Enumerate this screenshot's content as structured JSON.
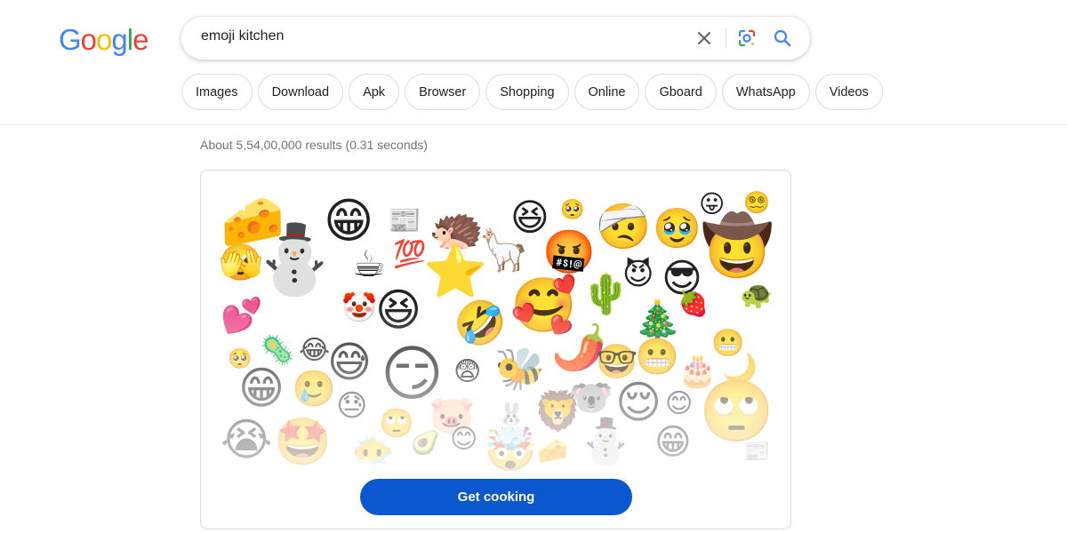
{
  "logo": {
    "letters": [
      "G",
      "o",
      "o",
      "g",
      "l",
      "e"
    ],
    "colors": [
      "#4285F4",
      "#EA4335",
      "#FBBC05",
      "#4285F4",
      "#34A853",
      "#EA4335"
    ]
  },
  "search": {
    "value": "emoji kitchen",
    "clear_icon": "close-icon",
    "lens_icon": "google-lens-icon",
    "search_icon": "search-icon"
  },
  "chips": [
    "Images",
    "Download",
    "Apk",
    "Browser",
    "Shopping",
    "Online",
    "Gboard",
    "WhatsApp",
    "Videos"
  ],
  "result_stats": "About 5,54,00,000 results (0.31 seconds)",
  "card": {
    "button_label": "Get cooking",
    "emojis": [
      "🧀",
      "⛄",
      "😁",
      "📰",
      "🦔",
      "😆",
      "🥺",
      "🤕",
      "🥹",
      "😛",
      "😵‍💫",
      "🤠",
      "🫣",
      "☕",
      "💯",
      "⭐",
      "🦙",
      "🤬",
      "😈",
      "😎",
      "💕",
      "🤡",
      "😆",
      "🤣",
      "🥰",
      "🌵",
      "🎄",
      "🍓",
      "🐢",
      "🥺",
      "🦠",
      "😂",
      "😅",
      "😏",
      "😨",
      "🐝",
      "🌶️",
      "🤓",
      "😬",
      "🎂",
      "😬",
      "🌙",
      "😁",
      "🥲",
      "😓",
      "🐨",
      "😌",
      "😊",
      "🙄",
      "😭",
      "🤩",
      "😶‍🌫️",
      "🙄",
      "🐷",
      "🐰",
      "🦁",
      "🥑",
      "😊",
      "🤯"
    ]
  }
}
